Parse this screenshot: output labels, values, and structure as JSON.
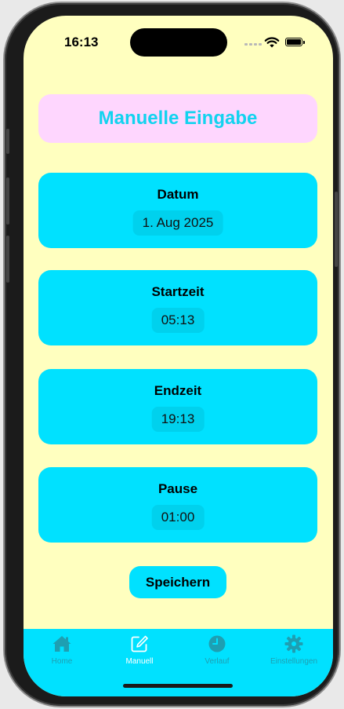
{
  "status": {
    "time": "16:13"
  },
  "header": {
    "title": "Manuelle Eingabe"
  },
  "fields": [
    {
      "label": "Datum",
      "value": "1. Aug 2025"
    },
    {
      "label": "Startzeit",
      "value": "05:13"
    },
    {
      "label": "Endzeit",
      "value": "19:13"
    },
    {
      "label": "Pause",
      "value": "01:00"
    }
  ],
  "actions": {
    "save_label": "Speichern"
  },
  "tabs": [
    {
      "label": "Home",
      "icon": "house-icon",
      "active": false
    },
    {
      "label": "Manuell",
      "icon": "edit-icon",
      "active": true
    },
    {
      "label": "Verlauf",
      "icon": "clock-icon",
      "active": false
    },
    {
      "label": "Einstellungen",
      "icon": "gear-icon",
      "active": false
    }
  ],
  "colors": {
    "background": "#ffffbf",
    "accent": "#00e1ff",
    "title_card": "#fed6fe",
    "title_text": "#12d3ef"
  }
}
